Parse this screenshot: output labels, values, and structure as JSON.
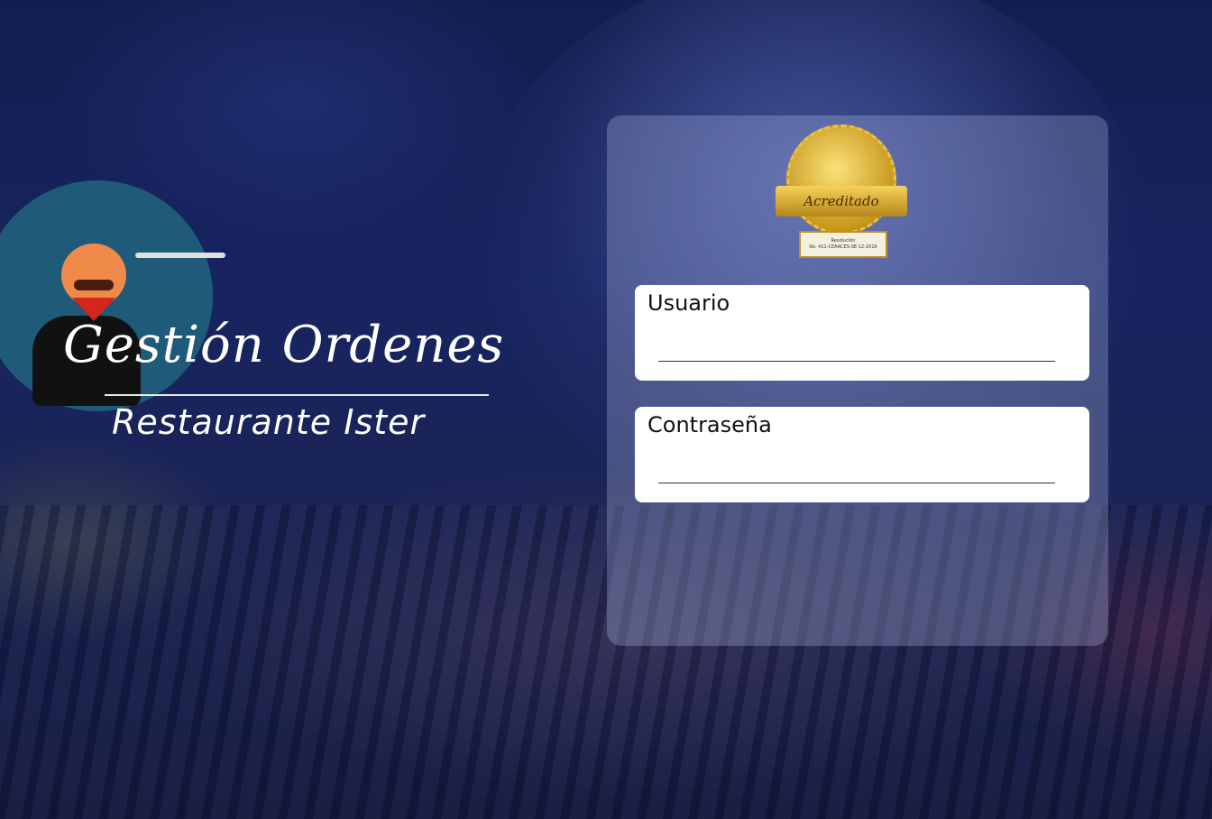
{
  "branding": {
    "title": "Gestión Ordenes",
    "subtitle": "Restaurante Ister"
  },
  "badge": {
    "ribbon_text": "Acreditado",
    "plaque_line1": "Resolución",
    "plaque_line2": "No. 411-CEAACES-SE-12-2016"
  },
  "login": {
    "username_label": "Usuario",
    "username_value": "",
    "password_label": "Contraseña",
    "password_value": ""
  },
  "colors": {
    "overlay": "#0f195a",
    "card": "#bec8f0",
    "field_bg": "#ffffff",
    "logo_plate": "#1f5a78",
    "badge_gold": "#c8971c"
  },
  "icons": {
    "logo": "chef-waiter-logo",
    "badge": "accreditation-seal"
  }
}
